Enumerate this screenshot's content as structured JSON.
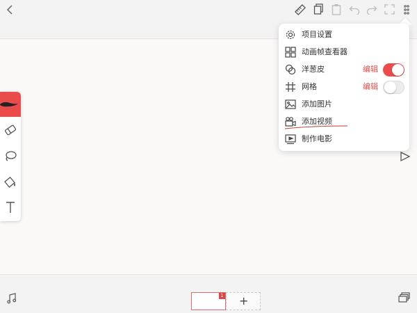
{
  "app": {
    "toolbar_icons": [
      "back-chevron-icon",
      "ruler-icon",
      "copy-icon",
      "paste-icon",
      "undo-icon",
      "redo-icon",
      "fullscreen-icon",
      "more-icon"
    ],
    "accent_color": "#ea4c4c"
  },
  "tools": [
    "brush-icon",
    "eraser-icon",
    "lasso-icon",
    "fill-bucket-icon",
    "text-icon"
  ],
  "menu": {
    "items": [
      {
        "label": "项目设置",
        "icon": "gear-icon"
      },
      {
        "label": "动画帧查看器",
        "icon": "grid-view-icon"
      },
      {
        "label": "洋葱皮",
        "icon": "onion-skin-icon",
        "edit": "编辑",
        "toggle": true
      },
      {
        "label": "网格",
        "icon": "hash-grid-icon",
        "edit": "编辑",
        "toggle": false
      },
      {
        "label": "添加图片",
        "icon": "image-icon"
      },
      {
        "label": "添加视频",
        "icon": "video-camera-icon"
      },
      {
        "label": "制作电影",
        "icon": "movie-icon"
      }
    ]
  },
  "bottom": {
    "frame_badge": "1",
    "add_frame_symbol": "+",
    "icons": [
      "music-note-icon",
      "layers-icon"
    ]
  },
  "playback": {
    "icon": "play-icon"
  }
}
